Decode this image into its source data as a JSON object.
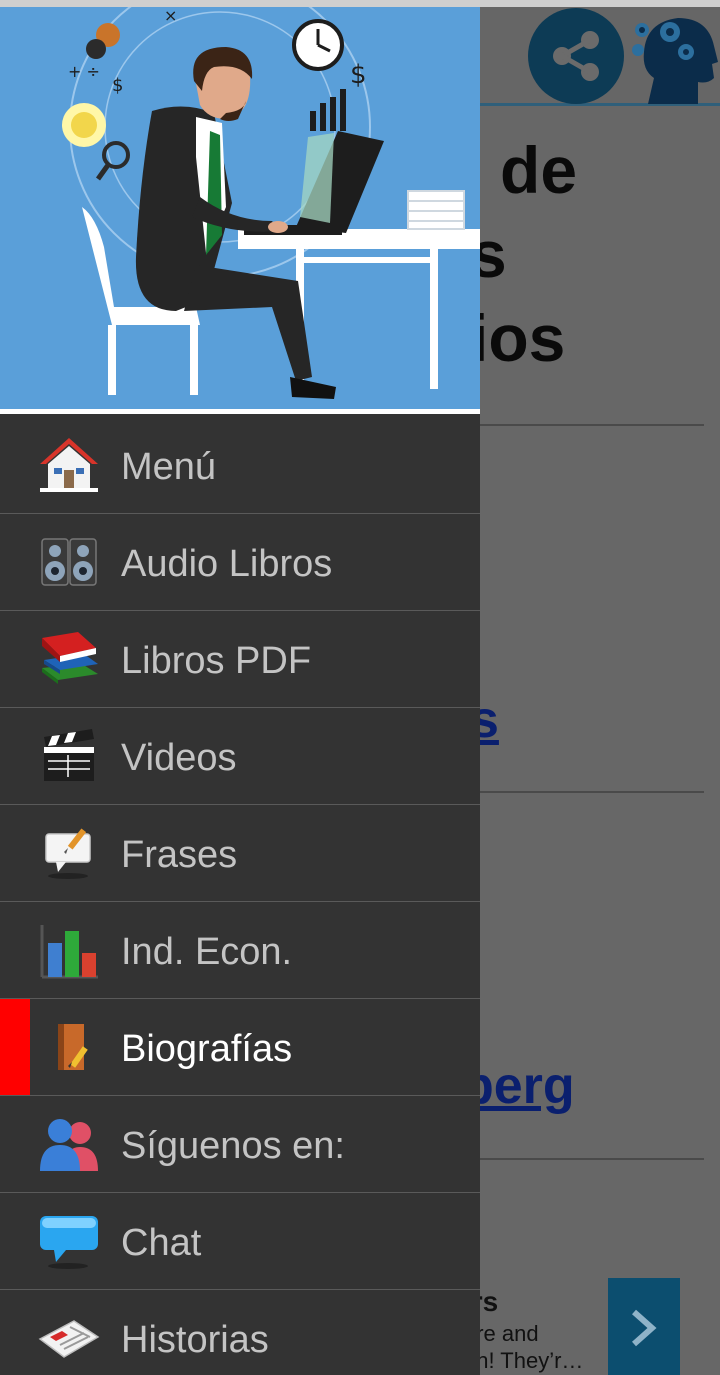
{
  "background": {
    "title_lines": [
      "de",
      "s",
      "ios"
    ],
    "links": [
      "s",
      "berg"
    ],
    "ad": {
      "title": "irs",
      "line1": "ore and",
      "line2": "on! They’r…"
    }
  },
  "drawer": {
    "active_color": "#ff0000",
    "items": [
      {
        "label": "Menú",
        "icon": "house-icon"
      },
      {
        "label": "Audio Libros",
        "icon": "speakers-icon"
      },
      {
        "label": "Libros PDF",
        "icon": "books-stack-icon"
      },
      {
        "label": "Videos",
        "icon": "clapperboard-icon"
      },
      {
        "label": "Frases",
        "icon": "speech-note-icon"
      },
      {
        "label": "Ind. Econ.",
        "icon": "bar-chart-icon"
      },
      {
        "label": "Biografías",
        "icon": "notebook-pencil-icon",
        "active": true
      },
      {
        "label": "Síguenos en:",
        "icon": "users-icon"
      },
      {
        "label": "Chat",
        "icon": "chat-bubble-icon"
      },
      {
        "label": "Historias",
        "icon": "newspaper-icon"
      }
    ]
  }
}
